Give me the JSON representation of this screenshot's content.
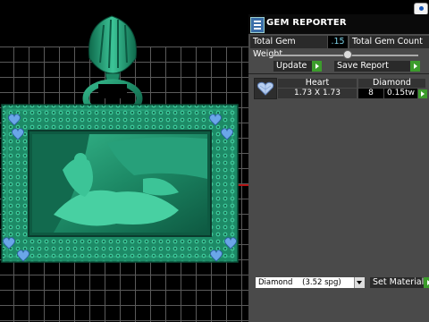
{
  "panel": {
    "title": "GEM REPORTER",
    "total_weight_label": "Total Gem Weight",
    "total_weight_value": ".15",
    "total_count_label": "Total Gem Count",
    "update_label": "Update",
    "save_report_label": "Save Report",
    "table": {
      "headers": [
        "Heart",
        "Diamond"
      ],
      "row": {
        "size": "1.73 X 1.73",
        "count": "8",
        "weight": "0.15tw"
      }
    },
    "material_select": "Diamond    (3.52 spg)",
    "set_material_label": "Set Material"
  },
  "colors": {
    "model_green": "#1d8a66",
    "accent_go": "#3c9c2c",
    "value_text": "#7dd3e8"
  },
  "icons": [
    "gem-reporter-icon",
    "app-corner-icon",
    "heart-gem-icon"
  ]
}
